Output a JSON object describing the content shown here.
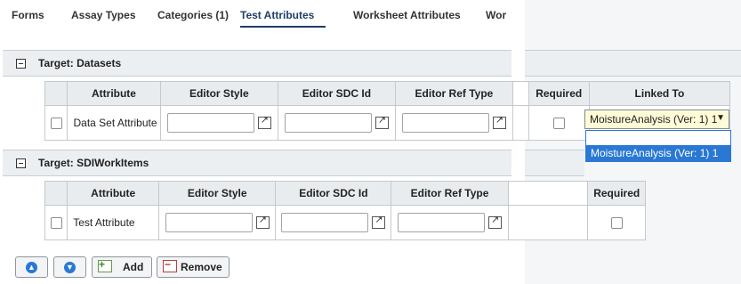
{
  "tabs": [
    {
      "label": "Forms"
    },
    {
      "label": "Assay Types"
    },
    {
      "label": "Categories (1)"
    },
    {
      "label": "Test Attributes",
      "active": true
    },
    {
      "label": "Worksheet Attributes"
    },
    {
      "label": "Wor"
    }
  ],
  "sections": [
    {
      "title": "Target: Datasets",
      "columns": [
        "Attribute",
        "Editor Style",
        "Editor SDC Id",
        "Editor Ref Type",
        "Required",
        "Linked To"
      ],
      "rows": [
        {
          "attribute": "Data Set Attribute",
          "linked_to": "MoistureAnalysis (Ver: 1) 1"
        }
      ]
    },
    {
      "title": "Target: SDIWorkItems",
      "columns": [
        "Attribute",
        "Editor Style",
        "Editor SDC Id",
        "Editor Ref Type",
        "Required"
      ],
      "rows": [
        {
          "attribute": "Test Attribute"
        }
      ]
    }
  ],
  "dropdown": {
    "options": [
      "MoistureAnalysis (Ver: 1) 1"
    ]
  },
  "toolbar": {
    "add_label": "Add",
    "remove_label": "Remove"
  },
  "colors": {
    "accent": "#2a78d4",
    "header_bg": "#e8ecef",
    "select_bg": "#fffbd6"
  }
}
